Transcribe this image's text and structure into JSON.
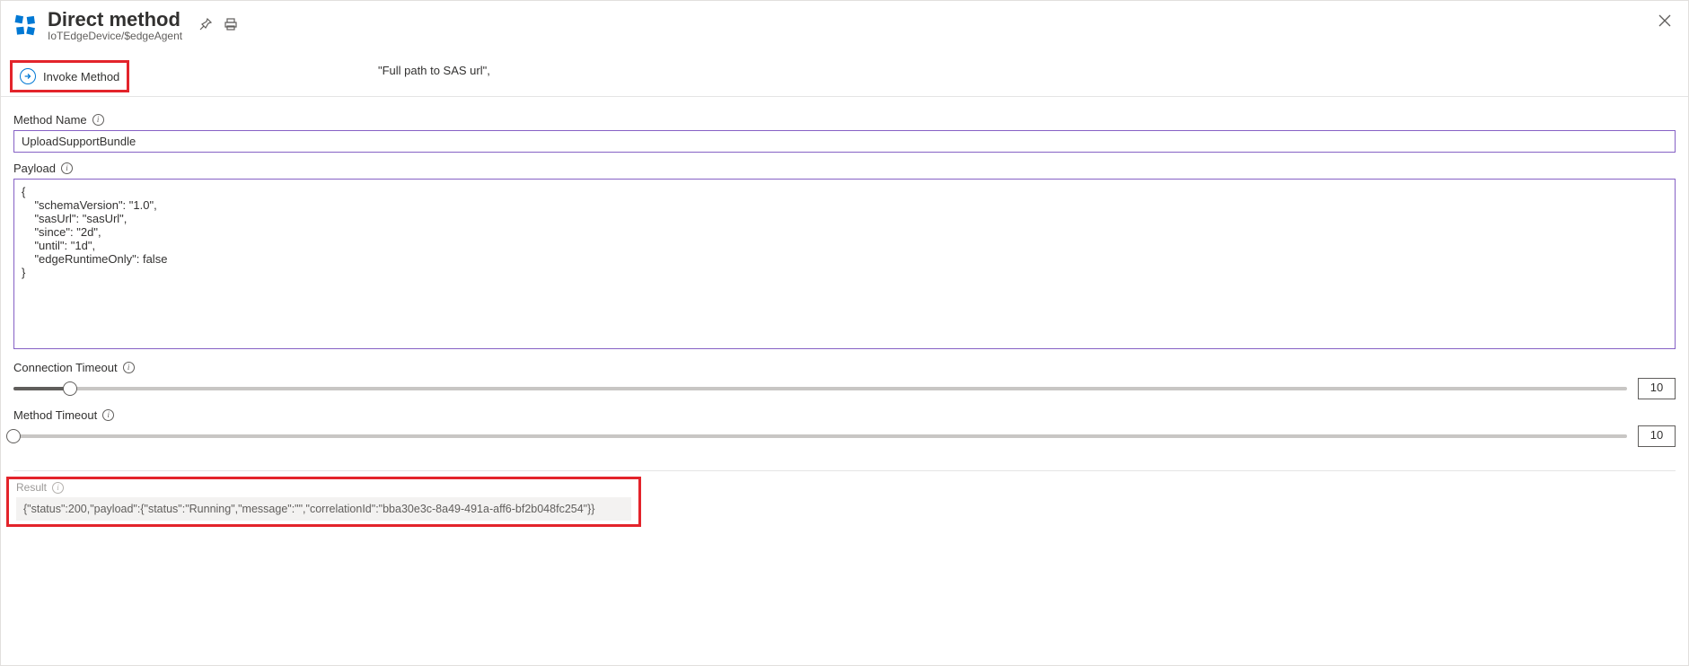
{
  "header": {
    "title": "Direct method",
    "subtitle": "IoTEdgeDevice/$edgeAgent"
  },
  "floating_text": "\"Full path to SAS url\",",
  "toolbar": {
    "invoke_label": "Invoke Method"
  },
  "method_name": {
    "label": "Method Name",
    "value": "UploadSupportBundle"
  },
  "payload": {
    "label": "Payload",
    "value": "{\n    \"schemaVersion\": \"1.0\",\n    \"sasUrl\": \"sasUrl\",\n    \"since\": \"2d\",\n    \"until\": \"1d\",\n    \"edgeRuntimeOnly\": false\n}"
  },
  "connection_timeout": {
    "label": "Connection Timeout",
    "value": "10",
    "fill_percent": 3.5
  },
  "method_timeout": {
    "label": "Method Timeout",
    "value": "10",
    "fill_percent": 0
  },
  "result": {
    "label": "Result",
    "value": "{\"status\":200,\"payload\":{\"status\":\"Running\",\"message\":\"\",\"correlationId\":\"bba30e3c-8a49-491a-aff6-bf2b048fc254\"}}"
  }
}
